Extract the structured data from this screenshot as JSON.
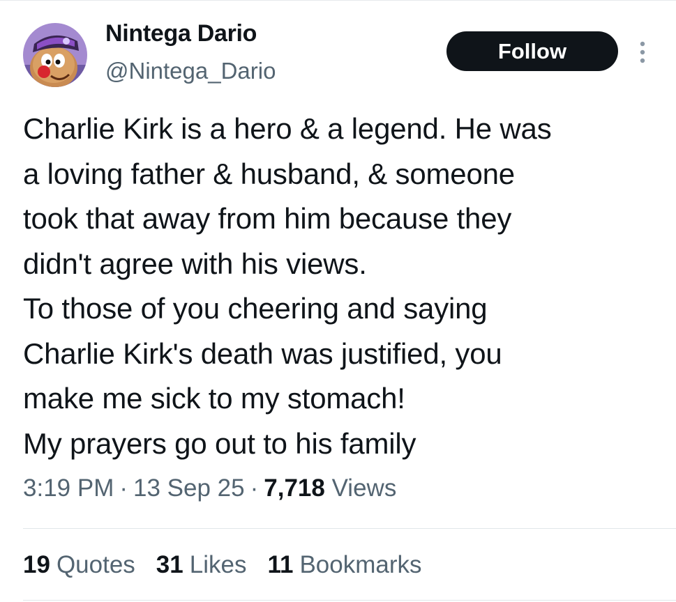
{
  "user": {
    "display_name": "Nintega Dario",
    "handle": "@Nintega_Dario",
    "avatar_icon": "potato-character-avatar"
  },
  "actions": {
    "follow_label": "Follow",
    "more_icon": "more-vertical-icon"
  },
  "tweet": {
    "lines": [
      "Charlie Kirk is a hero & a legend. He was",
      "a loving father & husband, & someone",
      "took that away from him because they",
      "didn't agree with his views.",
      "To those of you cheering and saying",
      "Charlie Kirk's death was justified, you",
      "make me sick to my stomach!",
      "My prayers go out to his family"
    ]
  },
  "meta": {
    "time": "3:19 PM",
    "separator": "·",
    "date": "13 Sep 25",
    "views_count": "7,718",
    "views_label": "Views"
  },
  "stats": {
    "quotes_count": "19",
    "quotes_label": "Quotes",
    "likes_count": "31",
    "likes_label": "Likes",
    "bookmarks_count": "11",
    "bookmarks_label": "Bookmarks"
  },
  "colors": {
    "text_primary": "#0f1419",
    "text_secondary": "#536471",
    "follow_bg": "#0f1419",
    "divider": "#e1e6ea"
  }
}
